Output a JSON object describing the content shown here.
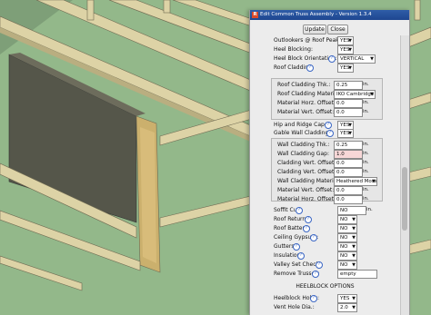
{
  "window": {
    "title": "Edit Common Truss Assembly - Version 1.3.4",
    "update_label": "Update",
    "close_label": "Close"
  },
  "rows": {
    "outlookers": {
      "label": "Outlookers @ Roof Peak:",
      "value": "YES"
    },
    "heel_blocking": {
      "label": "Heel Blocking:",
      "value": "YES"
    },
    "heel_block_orientation": {
      "label": "Heel Block Orientation:",
      "value": "VERTICAL"
    },
    "roof_cladding": {
      "label": "Roof Cladding:",
      "value": "YES"
    },
    "roof_cladding_thk": {
      "label": "Roof Cladding Thk.:",
      "value": "0.25",
      "unit": "in."
    },
    "roof_cladding_material": {
      "label": "Roof Cladding Material:",
      "value": "IKO Cambridge"
    },
    "material_horz_offset_1": {
      "label": "Material Horz. Offset:",
      "value": "0.0",
      "unit": "in."
    },
    "material_vert_offset_1": {
      "label": "Material Vert. Offset:",
      "value": "0.0",
      "unit": "in."
    },
    "hip_ridge_cap": {
      "label": "Hip and Ridge Cap:",
      "value": "YES"
    },
    "gable_wall_cladding": {
      "label": "Gable Wall Cladding:",
      "value": "YES"
    },
    "wall_cladding_thk": {
      "label": "Wall Cladding Thk.:",
      "value": "0.25",
      "unit": "in."
    },
    "wall_cladding_gap": {
      "label": "Wall Cladding Gap:",
      "value": "1.0",
      "unit": "in."
    },
    "cladding_vert_offset_t": {
      "label": "Cladding Vert. Offset (T):",
      "value": "0.0",
      "unit": "in."
    },
    "cladding_vert_offset_b": {
      "label": "Cladding Vert. Offset (B):",
      "value": "0.0",
      "unit": "in."
    },
    "wall_cladding_material": {
      "label": "Wall Cladding Material:",
      "value": "Heathered Moss"
    },
    "material_vert_offset_2": {
      "label": "Material Vert. Offset:",
      "value": "0.0",
      "unit": "in."
    },
    "material_horz_offset_2": {
      "label": "Material Horz. Offset:",
      "value": "0.0",
      "unit": "in."
    },
    "soffit_cut": {
      "label": "Soffit Cut:",
      "value": "NO",
      "unit": "in."
    },
    "roof_returns": {
      "label": "Roof Returns:",
      "value": "NO"
    },
    "roof_battens": {
      "label": "Roof Battens:",
      "value": "NO"
    },
    "ceiling_gypsum": {
      "label": "Ceiling Gypsum:",
      "value": "NO"
    },
    "gutters": {
      "label": "Gutters:",
      "value": "NO"
    },
    "insulation": {
      "label": "Insulation:",
      "value": "NO"
    },
    "valley_set_check": {
      "label": "Valley Set Check:",
      "value": "NO"
    },
    "remove_trusses": {
      "label": "Remove Trusses:",
      "value": "empty"
    },
    "heelblock_holes": {
      "label": "Heelblock Holes:",
      "value": "YES"
    },
    "vent_hole_dia": {
      "label": "Vent Hole Dia.:",
      "value": "2.0"
    }
  },
  "section_header": "HEELBLOCK OPTIONS",
  "icons": {
    "help": "?",
    "title": "R"
  },
  "colors": {
    "titlebar": "#2a55a0",
    "ground": "#93b88a",
    "lumber": "#ddd3a6"
  }
}
